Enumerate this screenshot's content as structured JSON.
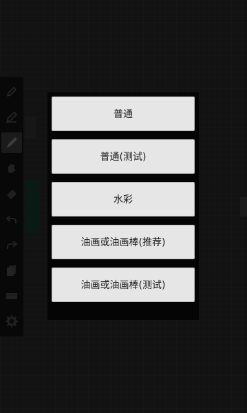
{
  "toolbar": {
    "tools": [
      {
        "icon": "pencil-icon"
      },
      {
        "icon": "pen-icon"
      },
      {
        "icon": "brush-icon",
        "active": true
      },
      {
        "icon": "smudge-icon"
      },
      {
        "icon": "eraser-icon"
      },
      {
        "icon": "undo-icon"
      },
      {
        "icon": "redo-icon"
      },
      {
        "icon": "layers-icon"
      },
      {
        "icon": "canvas-icon"
      },
      {
        "icon": "gear-icon"
      }
    ]
  },
  "brush_menu": {
    "items": [
      {
        "label": "普通"
      },
      {
        "label": "普通(测试)"
      },
      {
        "label": "水彩"
      },
      {
        "label": "油画或油画棒(推荐)"
      },
      {
        "label": "油画或油画棒(测试)"
      }
    ]
  },
  "colors": {
    "background": "#1d1d1d",
    "toolbar": "#0d0d0d",
    "dialog": "#050505",
    "menu_item": "#e6e6e6",
    "swatch": "#0b2a1f"
  }
}
